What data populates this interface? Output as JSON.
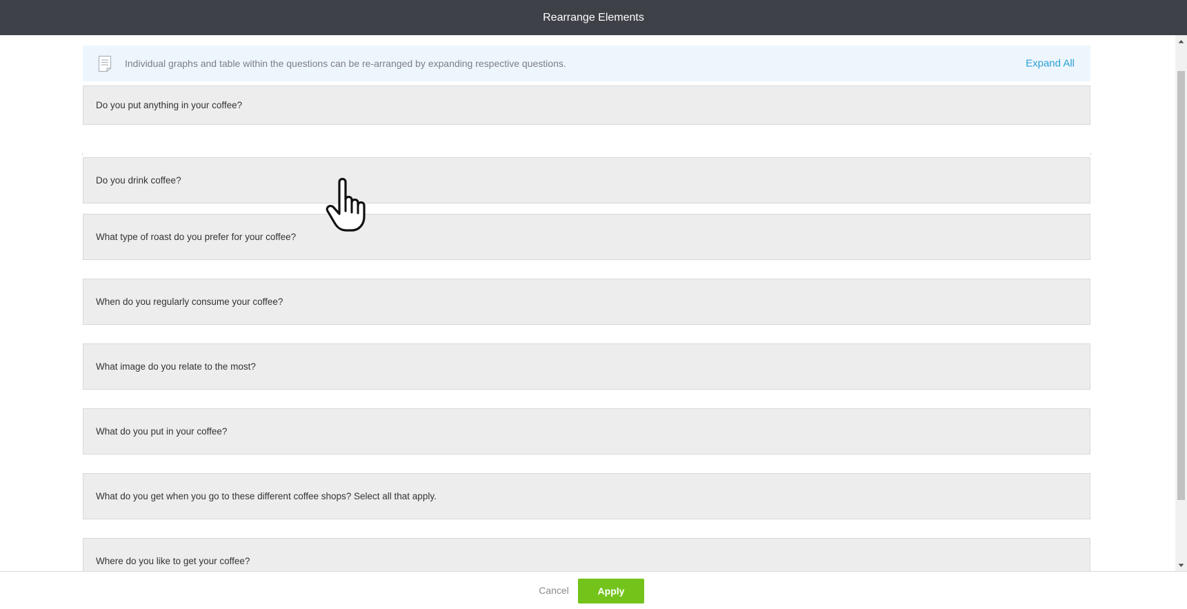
{
  "header": {
    "title": "Rearrange Elements"
  },
  "info": {
    "text": "Individual graphs and table within the questions can be re-arranged by expanding respective questions.",
    "expand_all_label": "Expand All",
    "icon": "document-icon"
  },
  "questions": [
    "Do you put anything in your coffee?",
    "Do you drink coffee?",
    "What type of roast do you prefer for your coffee?",
    "When do you regularly consume your coffee?",
    "What image do you relate to the most?",
    "What do you put in your coffee?",
    "What do you get when you go to these different coffee shops? Select all that apply.",
    "Where do you like to get your coffee?"
  ],
  "footer": {
    "cancel_label": "Cancel",
    "apply_label": "Apply"
  },
  "colors": {
    "header_bg": "#3e4148",
    "apply_bg": "#73c31b",
    "link": "#2a9fd6",
    "info_bg": "#eef6fd",
    "item_bg": "#ededed"
  }
}
